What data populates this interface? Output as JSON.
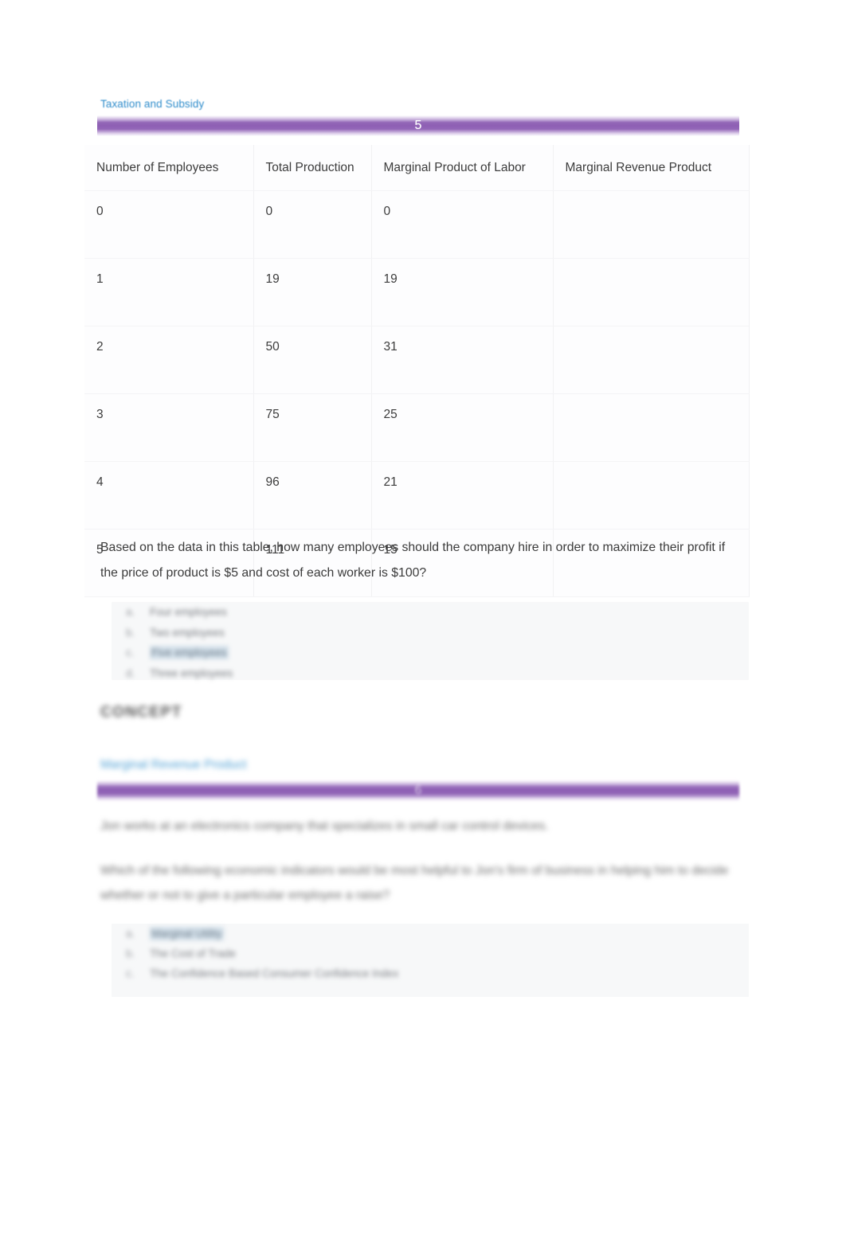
{
  "breadcrumb": {
    "label": "Taxation and Subsidy"
  },
  "bars": [
    {
      "number": "5"
    },
    {
      "number": "6"
    }
  ],
  "table": {
    "columns": [
      "Number of Employees",
      "Total Production",
      "Marginal Product of Labor",
      "Marginal Revenue Product"
    ],
    "rows": [
      {
        "employees": "0",
        "total_production": "0",
        "marginal_product": "0",
        "marginal_revenue_product": ""
      },
      {
        "employees": "1",
        "total_production": "19",
        "marginal_product": "19",
        "marginal_revenue_product": ""
      },
      {
        "employees": "2",
        "total_production": "50",
        "marginal_product": "31",
        "marginal_revenue_product": ""
      },
      {
        "employees": "3",
        "total_production": "75",
        "marginal_product": "25",
        "marginal_revenue_product": ""
      },
      {
        "employees": "4",
        "total_production": "96",
        "marginal_product": "21",
        "marginal_revenue_product": ""
      },
      {
        "employees": "5",
        "total_production": "111",
        "marginal_product": "15",
        "marginal_revenue_product": ""
      }
    ]
  },
  "question": {
    "text": "Based on the data in this table, how many employees should the company hire in order to maximize their profit if the price of product is $5 and cost of each worker is $100?"
  },
  "answer_options": [
    {
      "letter": "a.",
      "label": "Four employees",
      "selected": false
    },
    {
      "letter": "b.",
      "label": "Two employees",
      "selected": false
    },
    {
      "letter": "c.",
      "label": "Five employees",
      "selected": true
    },
    {
      "letter": "d.",
      "label": "Three employees",
      "selected": false
    }
  ],
  "concept": {
    "heading": "CONCEPT",
    "link": "Marginal Revenue Product"
  },
  "paragraphs": [
    "Jon works at an electronics company that specializes in small car control devices.",
    "Which of the following economic indicators would be most helpful to Jon's firm of business in helping him to decide whether or not to give a particular employee a raise?"
  ],
  "bottom_options": [
    {
      "letter": "a.",
      "label": "Marginal Utility",
      "selected": true
    },
    {
      "letter": "b.",
      "label": "The Cost of Trade",
      "selected": false
    },
    {
      "letter": "c.",
      "label": "The Confidence Based Consumer Confidence Index",
      "selected": false
    }
  ],
  "colors": {
    "accent_purple": "#8e5fb4",
    "link_blue": "#2e8ccb",
    "selected_highlight": "#d3e0ea",
    "table_background": "#fdfdfe"
  }
}
